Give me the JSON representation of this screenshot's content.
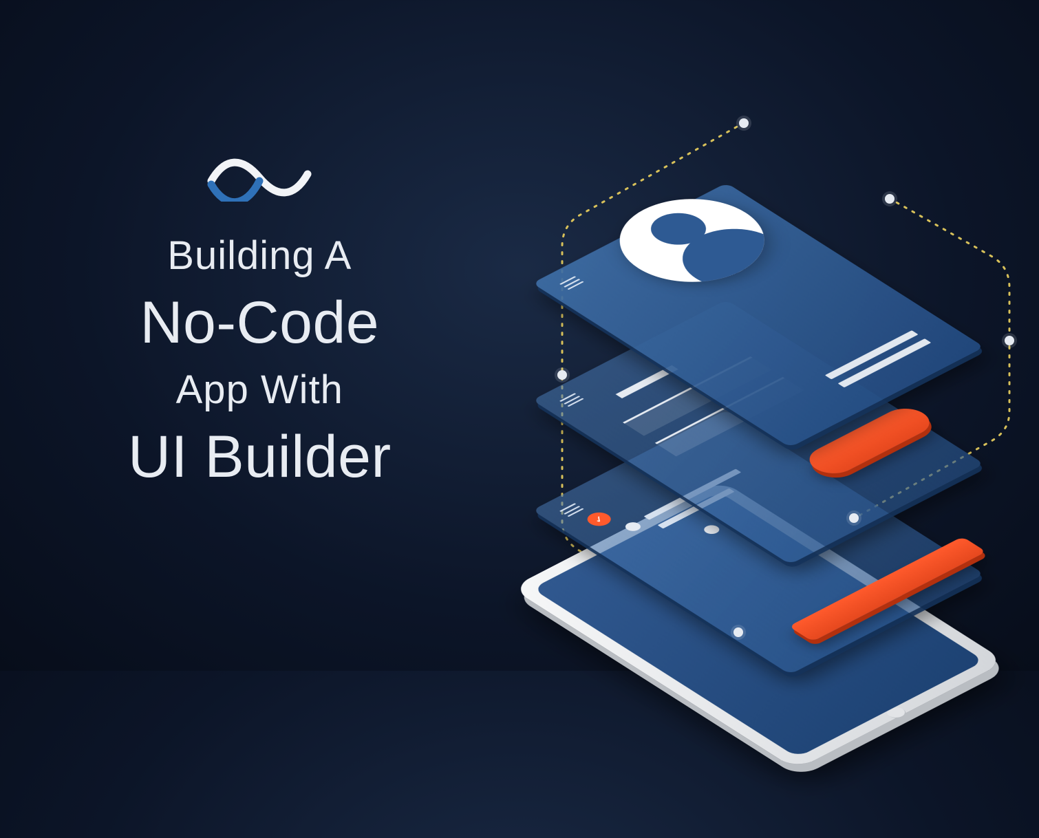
{
  "title": {
    "line1": "Building A",
    "line2": "No-Code",
    "line3": "App With",
    "line4": "UI Builder"
  },
  "colors": {
    "background_dark": "#0c1528",
    "panel_blue": "#2e5a93",
    "accent_orange": "#ff5a2c",
    "text": "#e8ecf2",
    "dashed": "#d8c15a"
  },
  "illustration": {
    "layers": [
      "profile-screen",
      "form-screen",
      "list-screen",
      "phone-device"
    ],
    "icons": [
      "hamburger-menu",
      "avatar",
      "checkmark-badge"
    ],
    "buttons": [
      "orange-pill-button",
      "orange-bar-button"
    ]
  }
}
